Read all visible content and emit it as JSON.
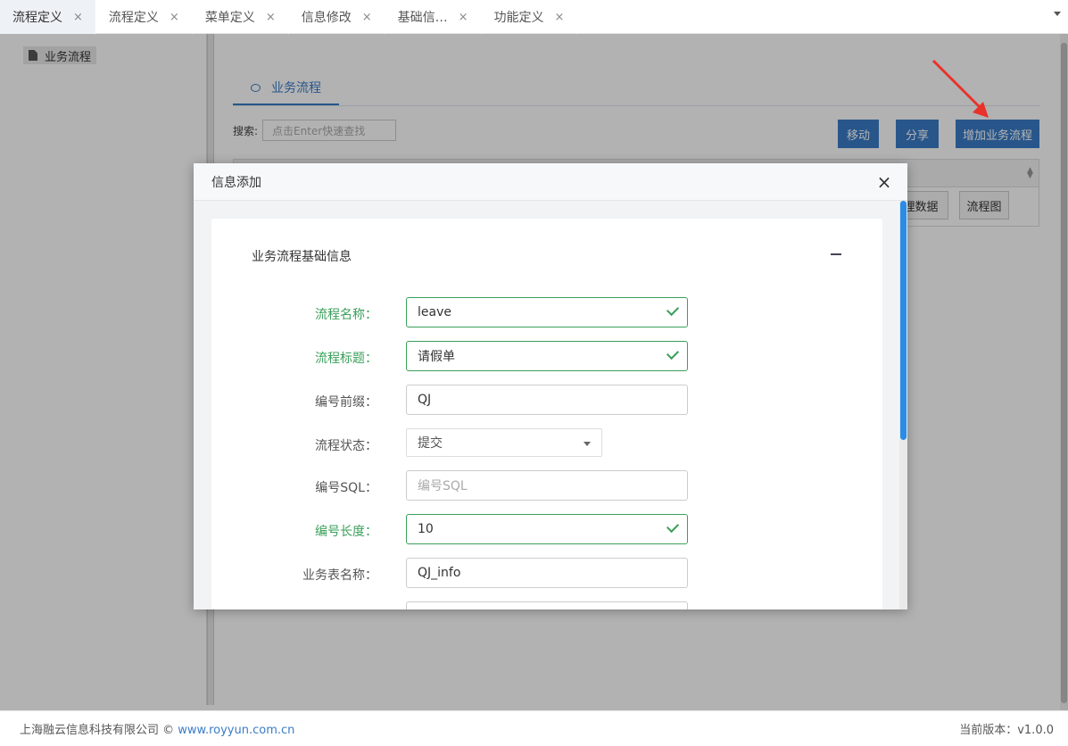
{
  "tabs": [
    {
      "label": "流程定义",
      "close": "×"
    },
    {
      "label": "流程定义",
      "close": "×"
    },
    {
      "label": "菜单定义",
      "close": "×"
    },
    {
      "label": "信息修改",
      "close": "×"
    },
    {
      "label": "基础信…",
      "close": "×"
    },
    {
      "label": "功能定义",
      "close": "×"
    }
  ],
  "sidebar": {
    "items": [
      {
        "label": "业务流程",
        "icon": "document-icon"
      }
    ]
  },
  "content": {
    "tab_label": "业务流程",
    "search_label": "搜索:",
    "search_placeholder": "点击Enter快速查找",
    "buttons": {
      "move": "移动",
      "share": "分享",
      "add": "增加业务流程"
    },
    "row_buttons": [
      "理数据",
      "流程图"
    ]
  },
  "modal": {
    "title": "信息添加",
    "close": "×",
    "section_title": "业务流程基础信息",
    "fields": [
      {
        "label": "流程名称：",
        "value": "leave",
        "state": "valid"
      },
      {
        "label": "流程标题：",
        "value": "请假单",
        "state": "valid"
      },
      {
        "label": "编号前缀：",
        "value": "QJ",
        "state": "normal"
      },
      {
        "label": "流程状态：",
        "value": "提交",
        "state": "select"
      },
      {
        "label": "编号SQL：",
        "value": "",
        "placeholder": "编号SQL",
        "state": "placeholder"
      },
      {
        "label": "编号长度：",
        "value": "10",
        "state": "valid"
      },
      {
        "label": "业务表名称：",
        "value": "QJ_info",
        "state": "normal"
      }
    ]
  },
  "footer": {
    "company": "上海融云信息科技有限公司 © ",
    "link": "www.royyun.com.cn",
    "version": "当前版本：v1.0.0"
  },
  "colors": {
    "accent": "#3a7cc7",
    "valid": "#3aa05a",
    "scroll": "#2b8ce6",
    "arrow": "#e8322a"
  }
}
